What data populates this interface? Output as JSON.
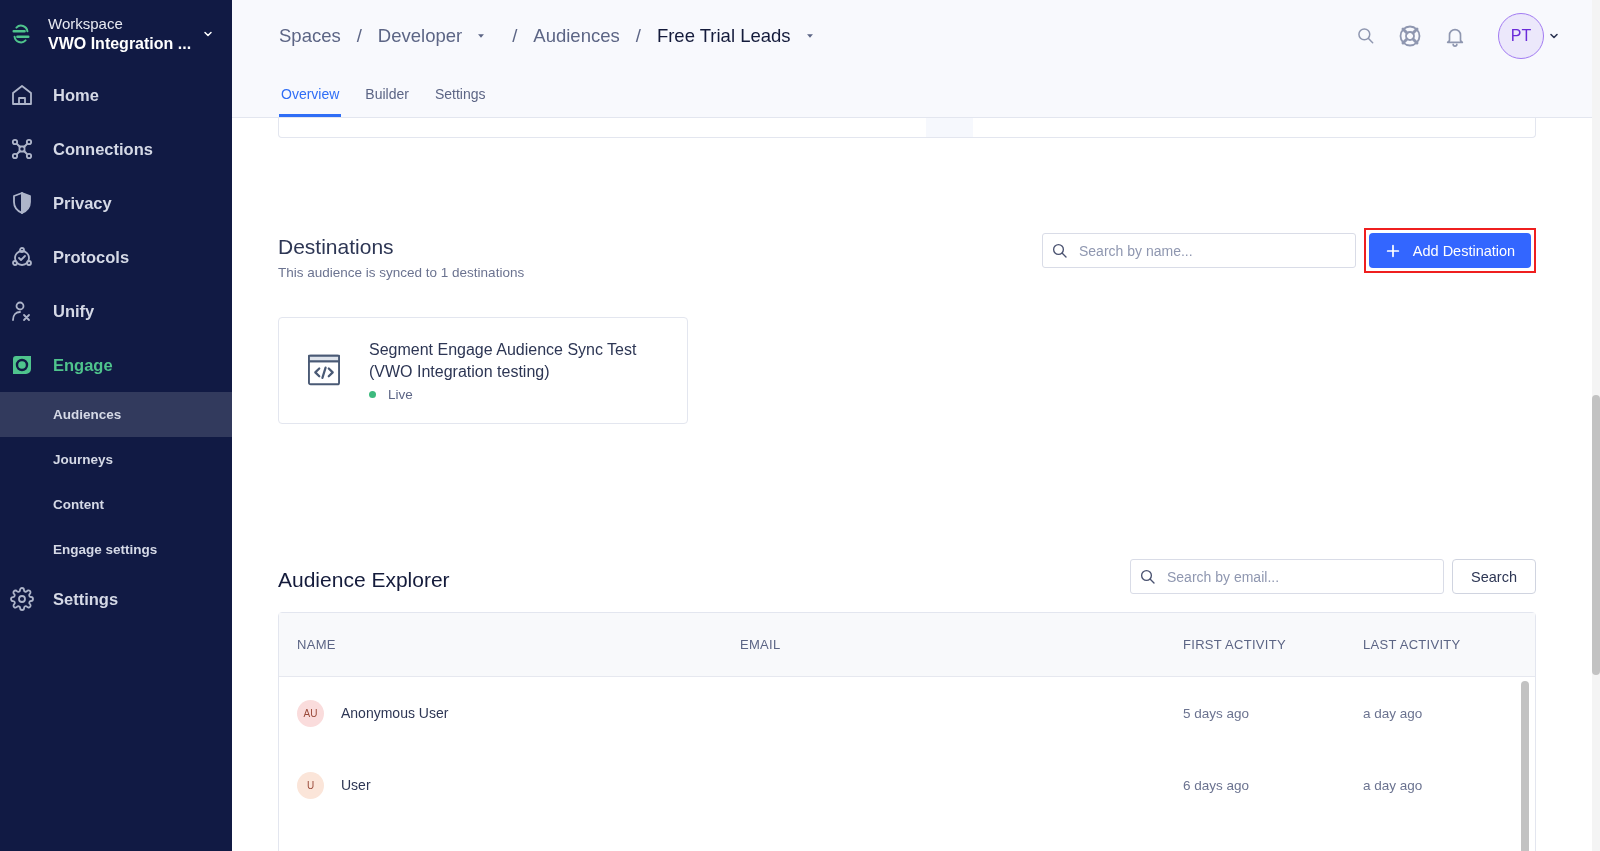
{
  "workspace": {
    "label": "Workspace",
    "name": "VWO Integration ..."
  },
  "sidebar": {
    "items": [
      {
        "label": "Home",
        "selected": false
      },
      {
        "label": "Connections",
        "selected": false
      },
      {
        "label": "Privacy",
        "selected": false
      },
      {
        "label": "Protocols",
        "selected": false
      },
      {
        "label": "Unify",
        "selected": false
      },
      {
        "label": "Engage",
        "selected": true,
        "expanded": true,
        "children": [
          {
            "label": "Audiences",
            "selected": true
          },
          {
            "label": "Journeys",
            "selected": false
          },
          {
            "label": "Content",
            "selected": false
          },
          {
            "label": "Engage settings",
            "selected": false
          }
        ]
      },
      {
        "label": "Settings",
        "selected": false
      }
    ]
  },
  "breadcrumb": [
    {
      "label": "Spaces",
      "dropdown": false,
      "current": false
    },
    {
      "label": "Developer",
      "dropdown": true,
      "current": false
    },
    {
      "label": "Audiences",
      "dropdown": false,
      "current": false
    },
    {
      "label": "Free Trial Leads",
      "dropdown": true,
      "current": true
    }
  ],
  "breadcrumb_separator": "/",
  "user": {
    "initials": "PT"
  },
  "tabs": [
    {
      "label": "Overview",
      "selected": true
    },
    {
      "label": "Builder",
      "selected": false
    },
    {
      "label": "Settings",
      "selected": false
    }
  ],
  "destinations": {
    "title": "Destinations",
    "subtitle": "This audience is synced to 1 destinations",
    "search": {
      "placeholder": "Search by name..."
    },
    "add_button": {
      "label": "Add Destination",
      "highlighted": true
    },
    "cards": [
      {
        "name": "Segment Engage Audience Sync Test (VWO Integration testing)",
        "status": "Live",
        "color": "#3dba7e"
      }
    ]
  },
  "explorer": {
    "title": "Audience Explorer",
    "search": {
      "placeholder": "Search by email..."
    },
    "search_button": "Search",
    "columns": [
      "NAME",
      "EMAIL",
      "FIRST ACTIVITY",
      "LAST ACTIVITY"
    ],
    "rows": [
      {
        "initials": "AU",
        "name": "Anonymous User",
        "email": "",
        "first_activity": "5 days ago",
        "last_activity": "a day ago",
        "color": "#fadcdc"
      },
      {
        "initials": "U",
        "name": "User",
        "email": "",
        "first_activity": "6 days ago",
        "last_activity": "a day ago",
        "color": "#fbe5d9"
      }
    ]
  }
}
